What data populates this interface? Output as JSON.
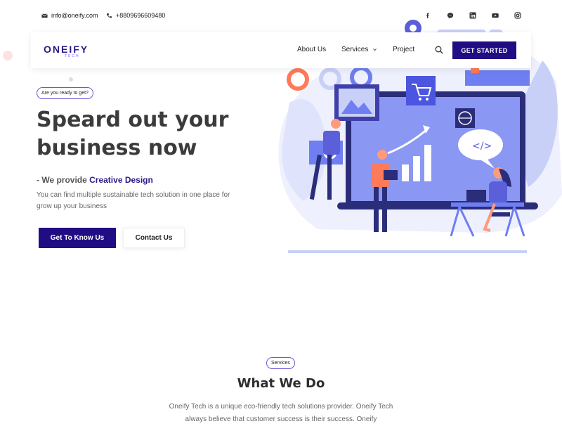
{
  "topbar": {
    "email": "info@oneify.com",
    "phone": "+8809696609480",
    "socials": [
      "facebook-icon",
      "messenger-icon",
      "linkedin-icon",
      "youtube-icon",
      "instagram-icon"
    ]
  },
  "nav": {
    "logo": "ONEIFY",
    "logo_sub": "TECH",
    "items": [
      "About Us",
      "Services",
      "Project"
    ],
    "cta": "GET STARTED"
  },
  "hero": {
    "badge": "Are you ready to get?",
    "title_line1": "Speard out your",
    "title_line2": "business now",
    "provide_prefix": "- We provide ",
    "provide_accent": "Creative Design",
    "description": "You can find multiple sustainable tech solution in one place for grow up your business",
    "btn_primary": "Get To Know Us",
    "btn_secondary": "Contact Us"
  },
  "services": {
    "badge": "Services",
    "title": "What We Do",
    "about": "Oneify Tech is a unique eco-friendly tech solutions provider. Oneify Tech always believe that customer success is their success. Oneify"
  },
  "colors": {
    "brand": "#210c84",
    "accent": "#6a58d9",
    "illus_blue": "#6f7ef0"
  }
}
